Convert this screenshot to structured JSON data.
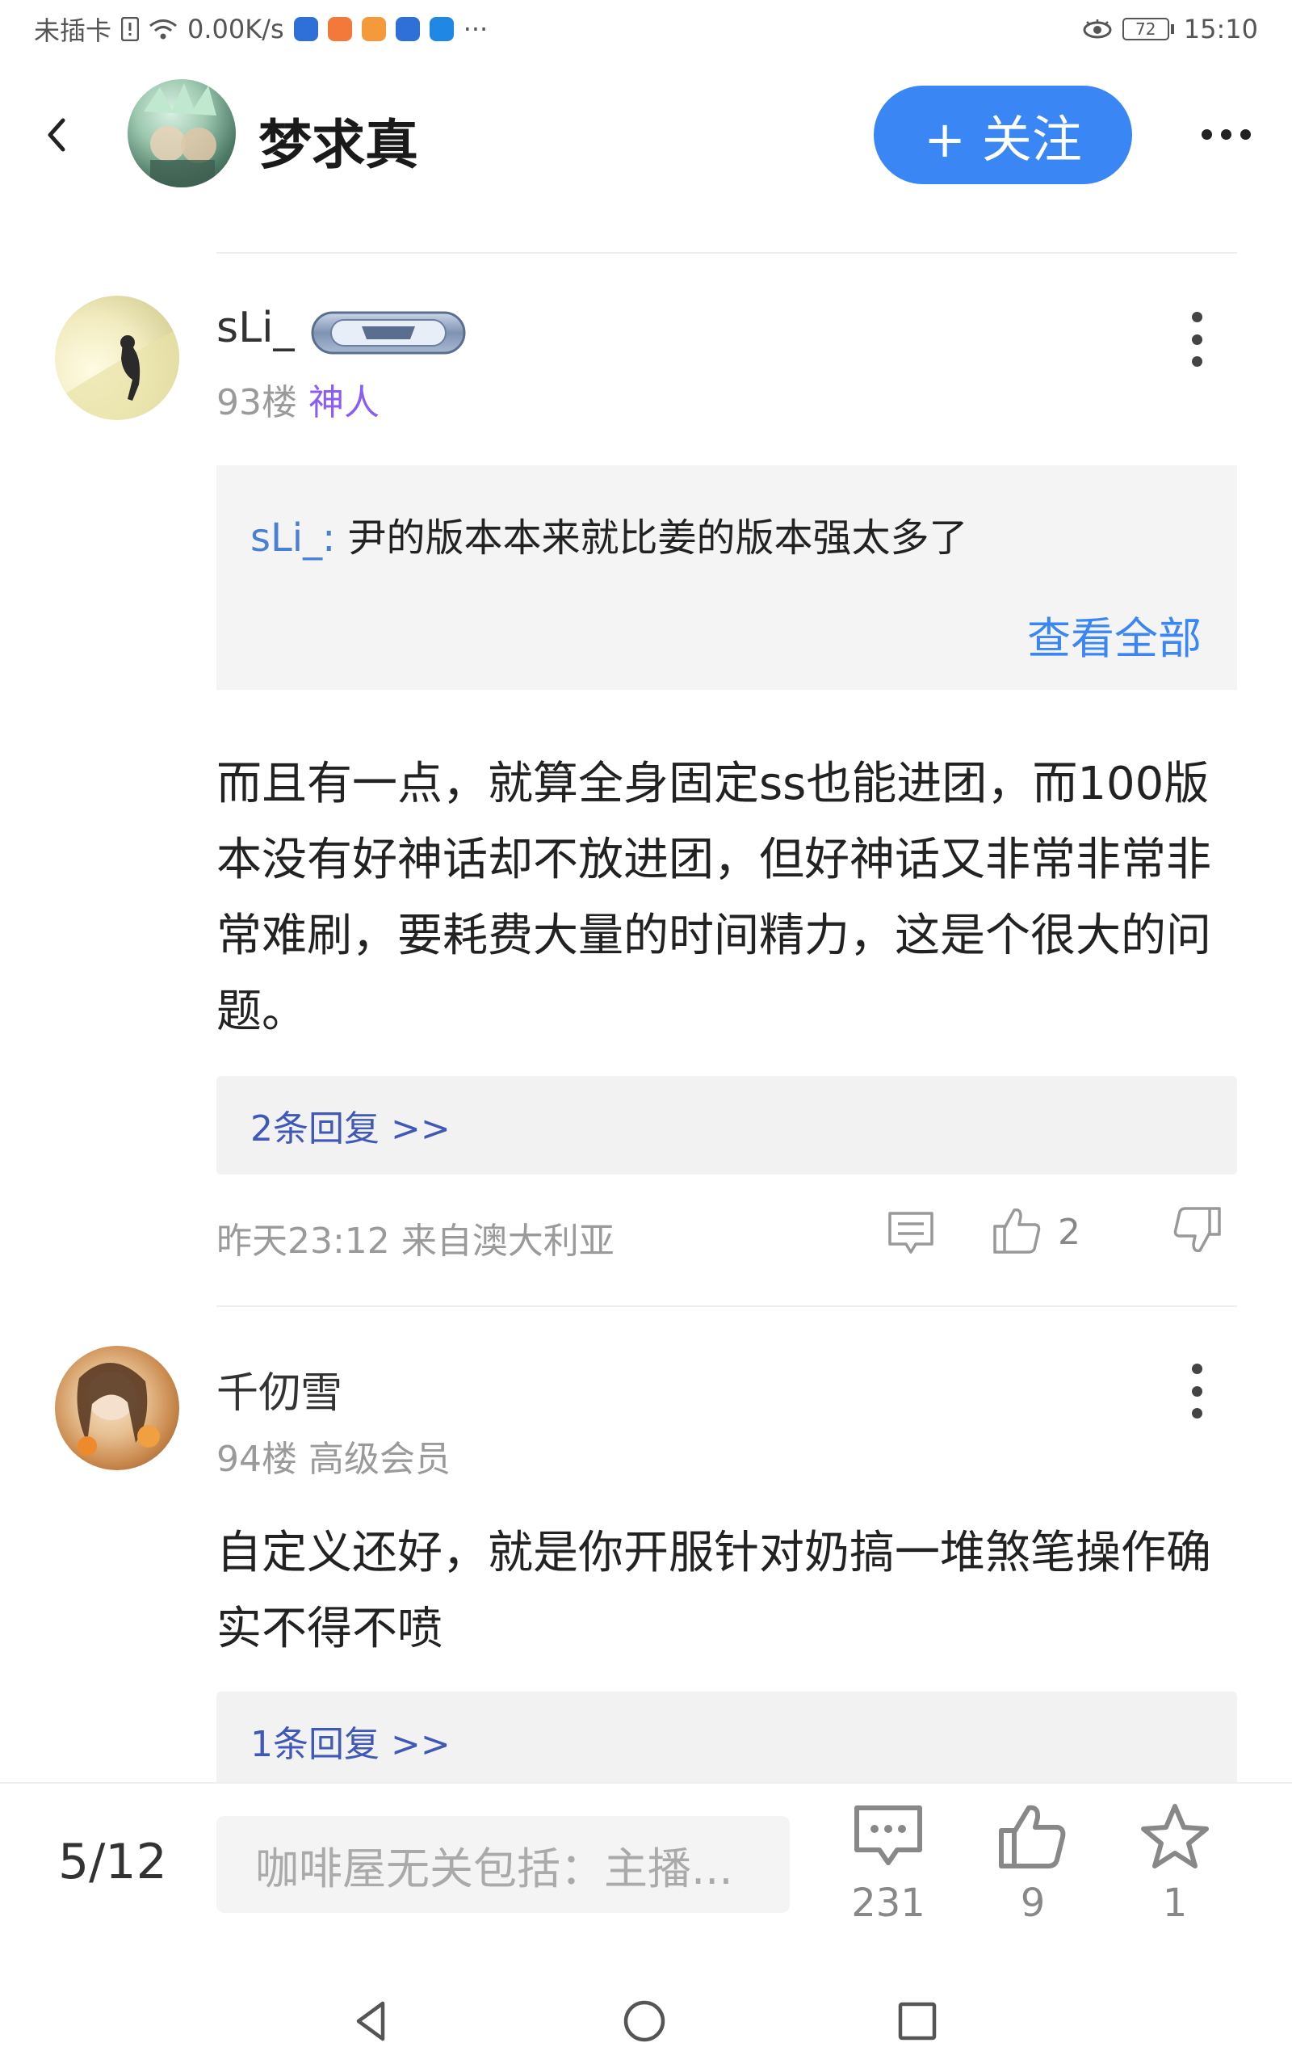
{
  "status_bar": {
    "carrier": "未插卡",
    "speed": "0.00K/s",
    "more": "···",
    "battery": "72",
    "time": "15:10"
  },
  "header": {
    "title": "梦求真",
    "follow_label": "+ 关注"
  },
  "floors": [
    {
      "username": "sLi_",
      "floor": "93楼",
      "title": "神人",
      "quote": {
        "name": "sLi_:",
        "text": "尹的版本本来就比姜的版本强太多了",
        "view_all": "查看全部"
      },
      "content": "而且有一点，就算全身固定ss也能进团，而100版本没有好神话却不放进团，但好神话又非常非常非常难刷，要耗费大量的时间精力，这是个很大的问题。",
      "replies": "2条回复 >>",
      "time": "昨天23:12",
      "location": "来自澳大利亚",
      "likes": "2"
    },
    {
      "username": "千仞雪",
      "floor": "94楼",
      "title": "高级会员",
      "content": "自定义还好，就是你开服针对奶搞一堆煞笔操作确实不得不喷",
      "replies": "1条回复 >>"
    }
  ],
  "bottom_bar": {
    "pager": "5/12",
    "reply_placeholder": "咖啡屋无关包括：主播...",
    "comment_count": "231",
    "like_count": "9",
    "star_count": "1"
  },
  "colors": {
    "accent": "#3a86f5",
    "title_purple": "#8b5cf6",
    "reply_link": "#4058b8"
  }
}
